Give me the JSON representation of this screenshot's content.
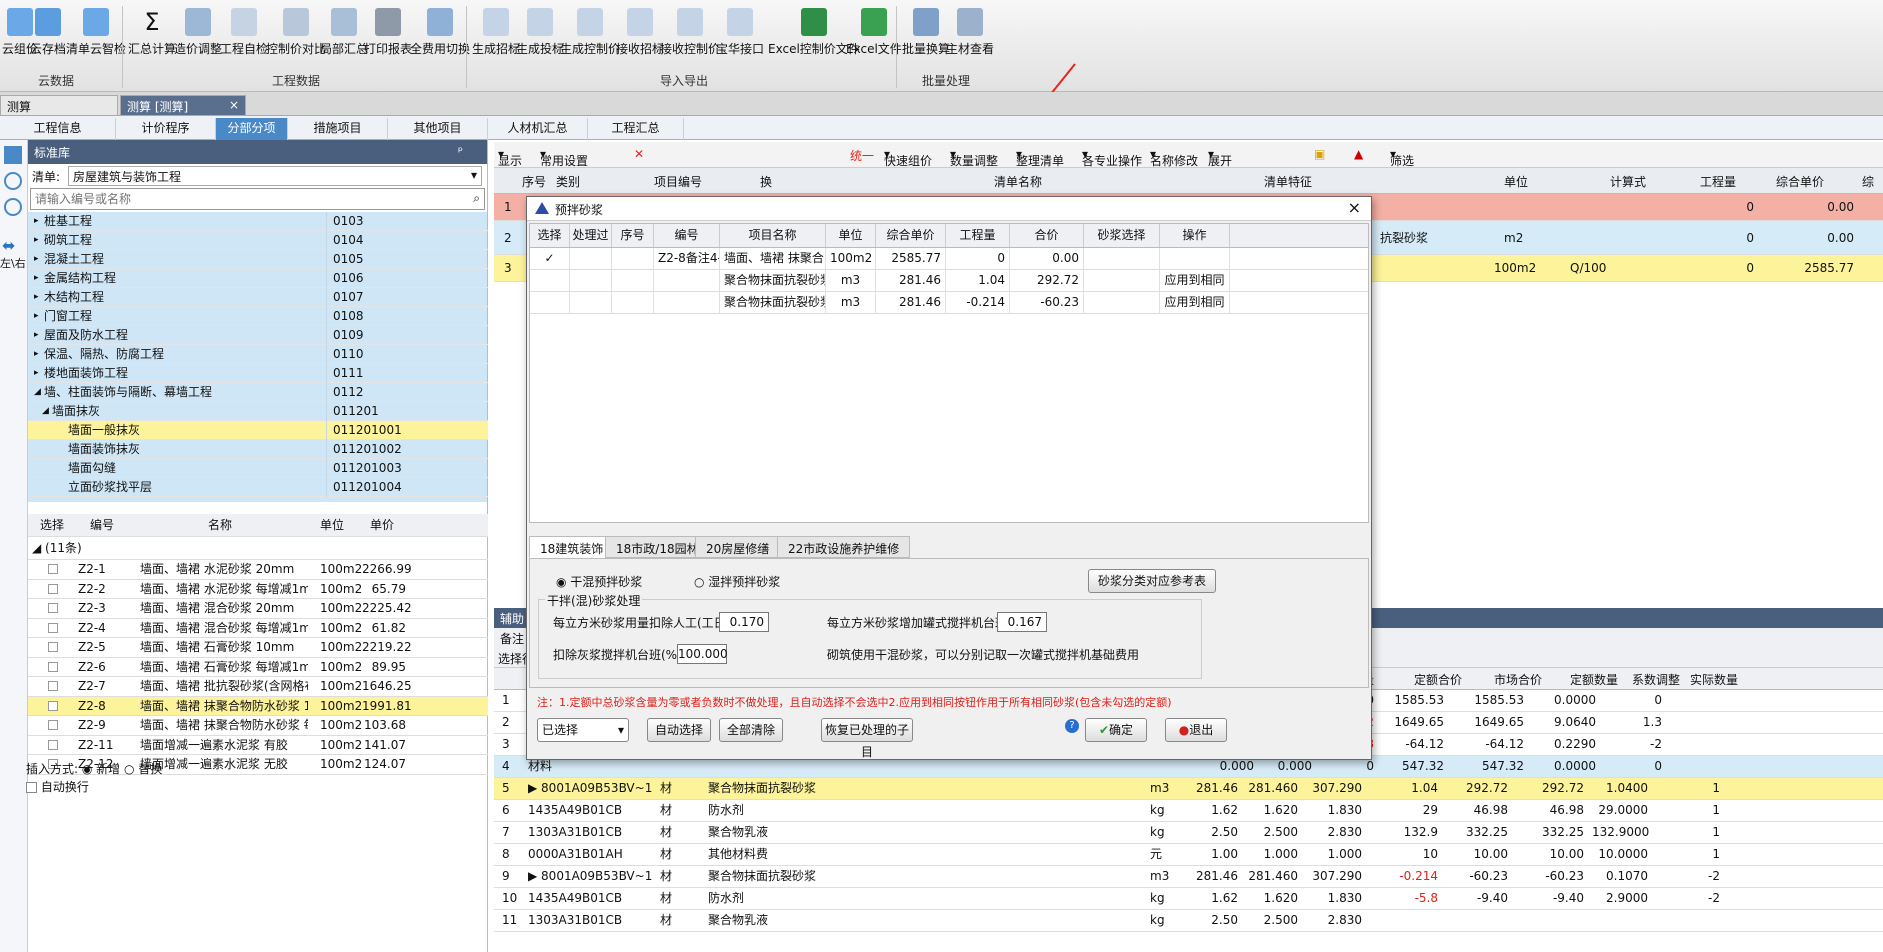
{
  "ribbon": {
    "buttons": [
      "云组价",
      "云存档",
      "清单云智检",
      "汇总计算",
      "造价调整",
      "工程自检",
      "控制价对比",
      "局部汇总",
      "打印报表",
      "全费用切换",
      "生成招标",
      "生成投标",
      "生成控制价",
      "接收招标",
      "接收控制价",
      "宝华接口",
      "Excel控制价文件",
      "Excel文件",
      "批量换算",
      "主材查看"
    ],
    "groups": [
      "云数据",
      "工程数据",
      "导入导出",
      "批量处理"
    ]
  },
  "doc_tabs": [
    "测算",
    "测算 [测算]"
  ],
  "doc_tab_close": "×",
  "main_tabs": [
    "工程信息",
    "计价程序",
    "分部分项",
    "措施项目",
    "其他项目",
    "人材机汇总",
    "工程汇总"
  ],
  "side_label": "左\\右",
  "left": {
    "title": "标准库",
    "pin": "ᵖ",
    "list_label": "清单:",
    "list_value": "房屋建筑与装饰工程",
    "search_placeholder": "请输入编号或名称",
    "tree": [
      {
        "name": "桩基工程",
        "code": "0103"
      },
      {
        "name": "砌筑工程",
        "code": "0104"
      },
      {
        "name": "混凝土工程",
        "code": "0105"
      },
      {
        "name": "金属结构工程",
        "code": "0106"
      },
      {
        "name": "木结构工程",
        "code": "0107"
      },
      {
        "name": "门窗工程",
        "code": "0108"
      },
      {
        "name": "屋面及防水工程",
        "code": "0109"
      },
      {
        "name": "保温、隔热、防腐工程",
        "code": "0110"
      },
      {
        "name": "楼地面装饰工程",
        "code": "0111"
      },
      {
        "name": "墙、柱面装饰与隔断、幕墙工程",
        "code": "0112"
      },
      {
        "name": "墙面抹灰",
        "code": "011201"
      },
      {
        "name": "墙面一般抹灰",
        "code": "011201001"
      },
      {
        "name": "墙面装饰抹灰",
        "code": "011201002"
      },
      {
        "name": "墙面勾缝",
        "code": "011201003"
      },
      {
        "name": "立面砂浆找平层",
        "code": "011201004"
      }
    ],
    "quota_headers": [
      "选择",
      "编号",
      "名称",
      "单位",
      "单价"
    ],
    "quota_group": "◢ (11条)",
    "quotas": [
      [
        "Z2-1",
        "墙面、墙裙 水泥砂浆 20mm",
        "100m2",
        "2266.99"
      ],
      [
        "Z2-2",
        "墙面、墙裙 水泥砂浆 每增减1mm",
        "100m2",
        "65.79"
      ],
      [
        "Z2-3",
        "墙面、墙裙 混合砂浆 20mm",
        "100m2",
        "2225.42"
      ],
      [
        "Z2-4",
        "墙面、墙裙 混合砂浆 每增减1mm",
        "100m2",
        "61.82"
      ],
      [
        "Z2-5",
        "墙面、墙裙 石膏砂浆 10mm",
        "100m2",
        "2219.22"
      ],
      [
        "Z2-6",
        "墙面、墙裙 石膏砂浆 每增减1mm",
        "100m2",
        "89.95"
      ],
      [
        "Z2-7",
        "墙面、墙裙 批抗裂砂浆(含网格布)",
        "100m2",
        "1646.25"
      ],
      [
        "Z2-8",
        "墙面、墙裙 抹聚合物防水砂浆 10mm",
        "100m2",
        "1991.81"
      ],
      [
        "Z2-9",
        "墙面、墙裙 抹聚合物防水砂浆 每增...",
        "100m2",
        "103.68"
      ],
      [
        "Z2-11",
        "墙面增减一遍素水泥浆 有胶",
        "100m2",
        "141.07"
      ],
      [
        "Z2-12",
        "墙面增减一遍素水泥浆 无胶",
        "100m2",
        "124.07"
      ]
    ],
    "insert_label": "插入方式:",
    "insert_new": "新增",
    "insert_replace": "替换",
    "auto_wrap": "自动换行"
  },
  "toolbar": [
    "显示",
    "常用设置",
    "统一",
    "快速组价",
    "数量调整",
    "整理清单",
    "各专业操作",
    "名称修改",
    "展开",
    "筛选"
  ],
  "grid_headers": [
    "序号",
    "类别",
    "项目编号",
    "换",
    "清单名称",
    "清单特征",
    "单位",
    "计算式",
    "工程量",
    "综合单价",
    "综"
  ],
  "grid_rows": [
    {
      "no": "1",
      "unit": "",
      "qty": "0",
      "price": "0.00"
    },
    {
      "no": "2",
      "name": "抗裂砂浆",
      "unit": "m2",
      "qty": "0",
      "price": "0.00"
    },
    {
      "no": "3",
      "unit": "100m2",
      "formula": "Q/100",
      "qty": "0",
      "price": "2585.77"
    }
  ],
  "aux": {
    "title": "辅助",
    "tabs": [
      "备注",
      "选择行"
    ],
    "headers": [
      "除税价",
      "含税价",
      "数量",
      "定额合价",
      "市场合价",
      "定额数量",
      "系数调整",
      "实际数量"
    ],
    "rows": [
      [
        "1",
        "",
        "",
        "",
        "0.000",
        "0.000",
        "0",
        "1585.53",
        "1585.53",
        "0.0000",
        "0",
        ""
      ],
      [
        "2",
        "",
        "",
        "",
        "140.000",
        "140.000",
        "11.7832",
        "1649.65",
        "1649.65",
        "9.0640",
        "1.3",
        ""
      ],
      [
        "3",
        "",
        "",
        "",
        "140.000",
        "140.000",
        "-0.458",
        "-64.12",
        "-64.12",
        "0.2290",
        "-2",
        ""
      ],
      [
        "4",
        "材料",
        "",
        "",
        "0.000",
        "0.000",
        "0",
        "547.32",
        "547.32",
        "0.0000",
        "0",
        ""
      ],
      [
        "5",
        "▶ 8001A09B53BV~1",
        "材",
        "聚合物抹面抗裂砂浆",
        "m3",
        "281.46",
        "281.460",
        "307.290",
        "1.04",
        "292.72",
        "292.72",
        "1.0400",
        "1"
      ],
      [
        "6",
        "1435A49B01CB",
        "材",
        "防水剂",
        "kg",
        "1.62",
        "1.620",
        "1.830",
        "29",
        "46.98",
        "46.98",
        "29.0000",
        "1"
      ],
      [
        "7",
        "1303A31B01CB",
        "材",
        "聚合物乳液",
        "kg",
        "2.50",
        "2.500",
        "2.830",
        "132.9",
        "332.25",
        "332.25",
        "132.9000",
        "1"
      ],
      [
        "8",
        "0000A31B01AH",
        "材",
        "其他材料费",
        "元",
        "1.00",
        "1.000",
        "1.000",
        "10",
        "10.00",
        "10.00",
        "10.0000",
        "1"
      ],
      [
        "9",
        "▶ 8001A09B53BV~1",
        "材",
        "聚合物抹面抗裂砂浆",
        "m3",
        "281.46",
        "281.460",
        "307.290",
        "-0.214",
        "-60.23",
        "-60.23",
        "0.1070",
        "-2"
      ],
      [
        "10",
        "1435A49B01CB",
        "材",
        "防水剂",
        "kg",
        "1.62",
        "1.620",
        "1.830",
        "-5.8",
        "-9.40",
        "-9.40",
        "2.9000",
        "-2"
      ],
      [
        "11",
        "1303A31B01CB",
        "材",
        "聚合物乳液",
        "kg",
        "2.50",
        "2.500",
        "2.830",
        "",
        "",
        "",
        "",
        ""
      ]
    ]
  },
  "dialog": {
    "title": "预拌砂浆",
    "close": "×",
    "headers": [
      "选择",
      "处理过",
      "序号",
      "编号",
      "项目名称",
      "单位",
      "综合单价",
      "工程量",
      "合价",
      "砂浆选择",
      "操作"
    ],
    "rows": [
      [
        "✓",
        "",
        "",
        "Z2-8备注4-[Z",
        "墙面、墙裙 抹聚合...",
        "100m2",
        "2585.77",
        "0",
        "0.00",
        "",
        ""
      ],
      [
        "",
        "",
        "",
        "",
        "聚合物抹面抗裂砂浆",
        "m3",
        "281.46",
        "1.04",
        "292.72",
        "",
        "应用到相同"
      ],
      [
        "",
        "",
        "",
        "",
        "聚合物抹面抗裂砂浆",
        "m3",
        "281.46",
        "-0.214",
        "-60.23",
        "",
        "应用到相同"
      ]
    ],
    "tabs": [
      "18建筑装饰",
      "18市政/18园林",
      "20房屋修缮",
      "22市政设施养护维修"
    ],
    "dry": "干混预拌砂浆",
    "wet": "湿拌预拌砂浆",
    "ref_btn": "砂浆分类对应参考表",
    "section": "干拌(混)砂浆处理",
    "deduct_label": "每立方米砂浆用量扣除人工(工日):",
    "deduct_val": "0.170",
    "add_label": "每立方米砂浆增加罐式搅拌机台班:",
    "add_val": "0.167",
    "mixer_label": "扣除灰浆搅拌机台班(%):",
    "mixer_val": "100.000",
    "mixer_note": "砌筑使用干混砂浆，可以分别记取一次罐式搅拌机基础费用",
    "note": "注：1.定额中总砂浆含量为零或者负数时不做处理，且自动选择不会选中2.应用到相同按钮作用于所有相同砂浆(包含未勾选的定额)",
    "select_value": "已选择",
    "auto_select": "自动选择",
    "clear_all": "全部清除",
    "restore": "恢复已处理的子目",
    "ok": "确定",
    "exit": "退出"
  }
}
